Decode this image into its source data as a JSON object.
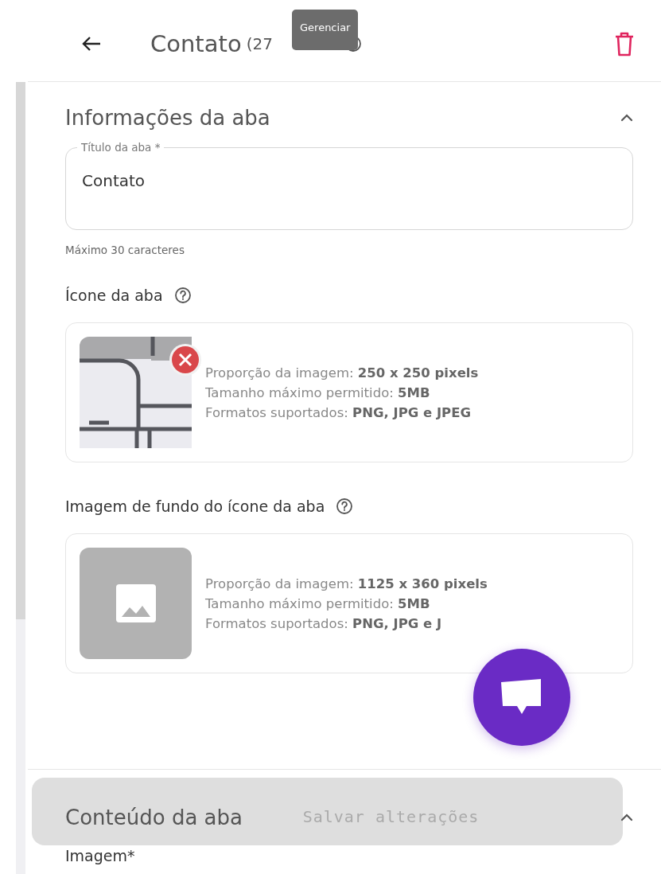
{
  "header": {
    "title": "Contato",
    "id_text": "(27",
    "tooltip": "Gerenciar"
  },
  "tab_info": {
    "title": "Informações da aba",
    "expanded": true,
    "title_field": {
      "label": "Título da aba *",
      "value": "Contato",
      "helper": "Máximo 30 caracteres"
    },
    "uploads": [
      {
        "label": "Ícone da aba",
        "has_image": true,
        "lines": [
          "Proporção da imagem: **250 x 250 pixels**",
          "Tamanho máximo permitido: **5MB**",
          "Formatos suportados: **PNG, JPG e JPEG**"
        ]
      },
      {
        "label": "Imagem de fundo do ícone da aba",
        "has_image": false,
        "lines": [
          "Proporção da imagem: **1125 x 360 pixels**",
          "Tamanho máximo permitido: **5MB**",
          "Formatos suportados: **PNG, JPG e J**"
        ]
      }
    ]
  },
  "tab_content": {
    "title": "Conteúdo da aba",
    "expanded": true,
    "image_label": "Imagem*"
  },
  "save_button": {
    "label": "Salvar alterações",
    "disabled": true
  }
}
